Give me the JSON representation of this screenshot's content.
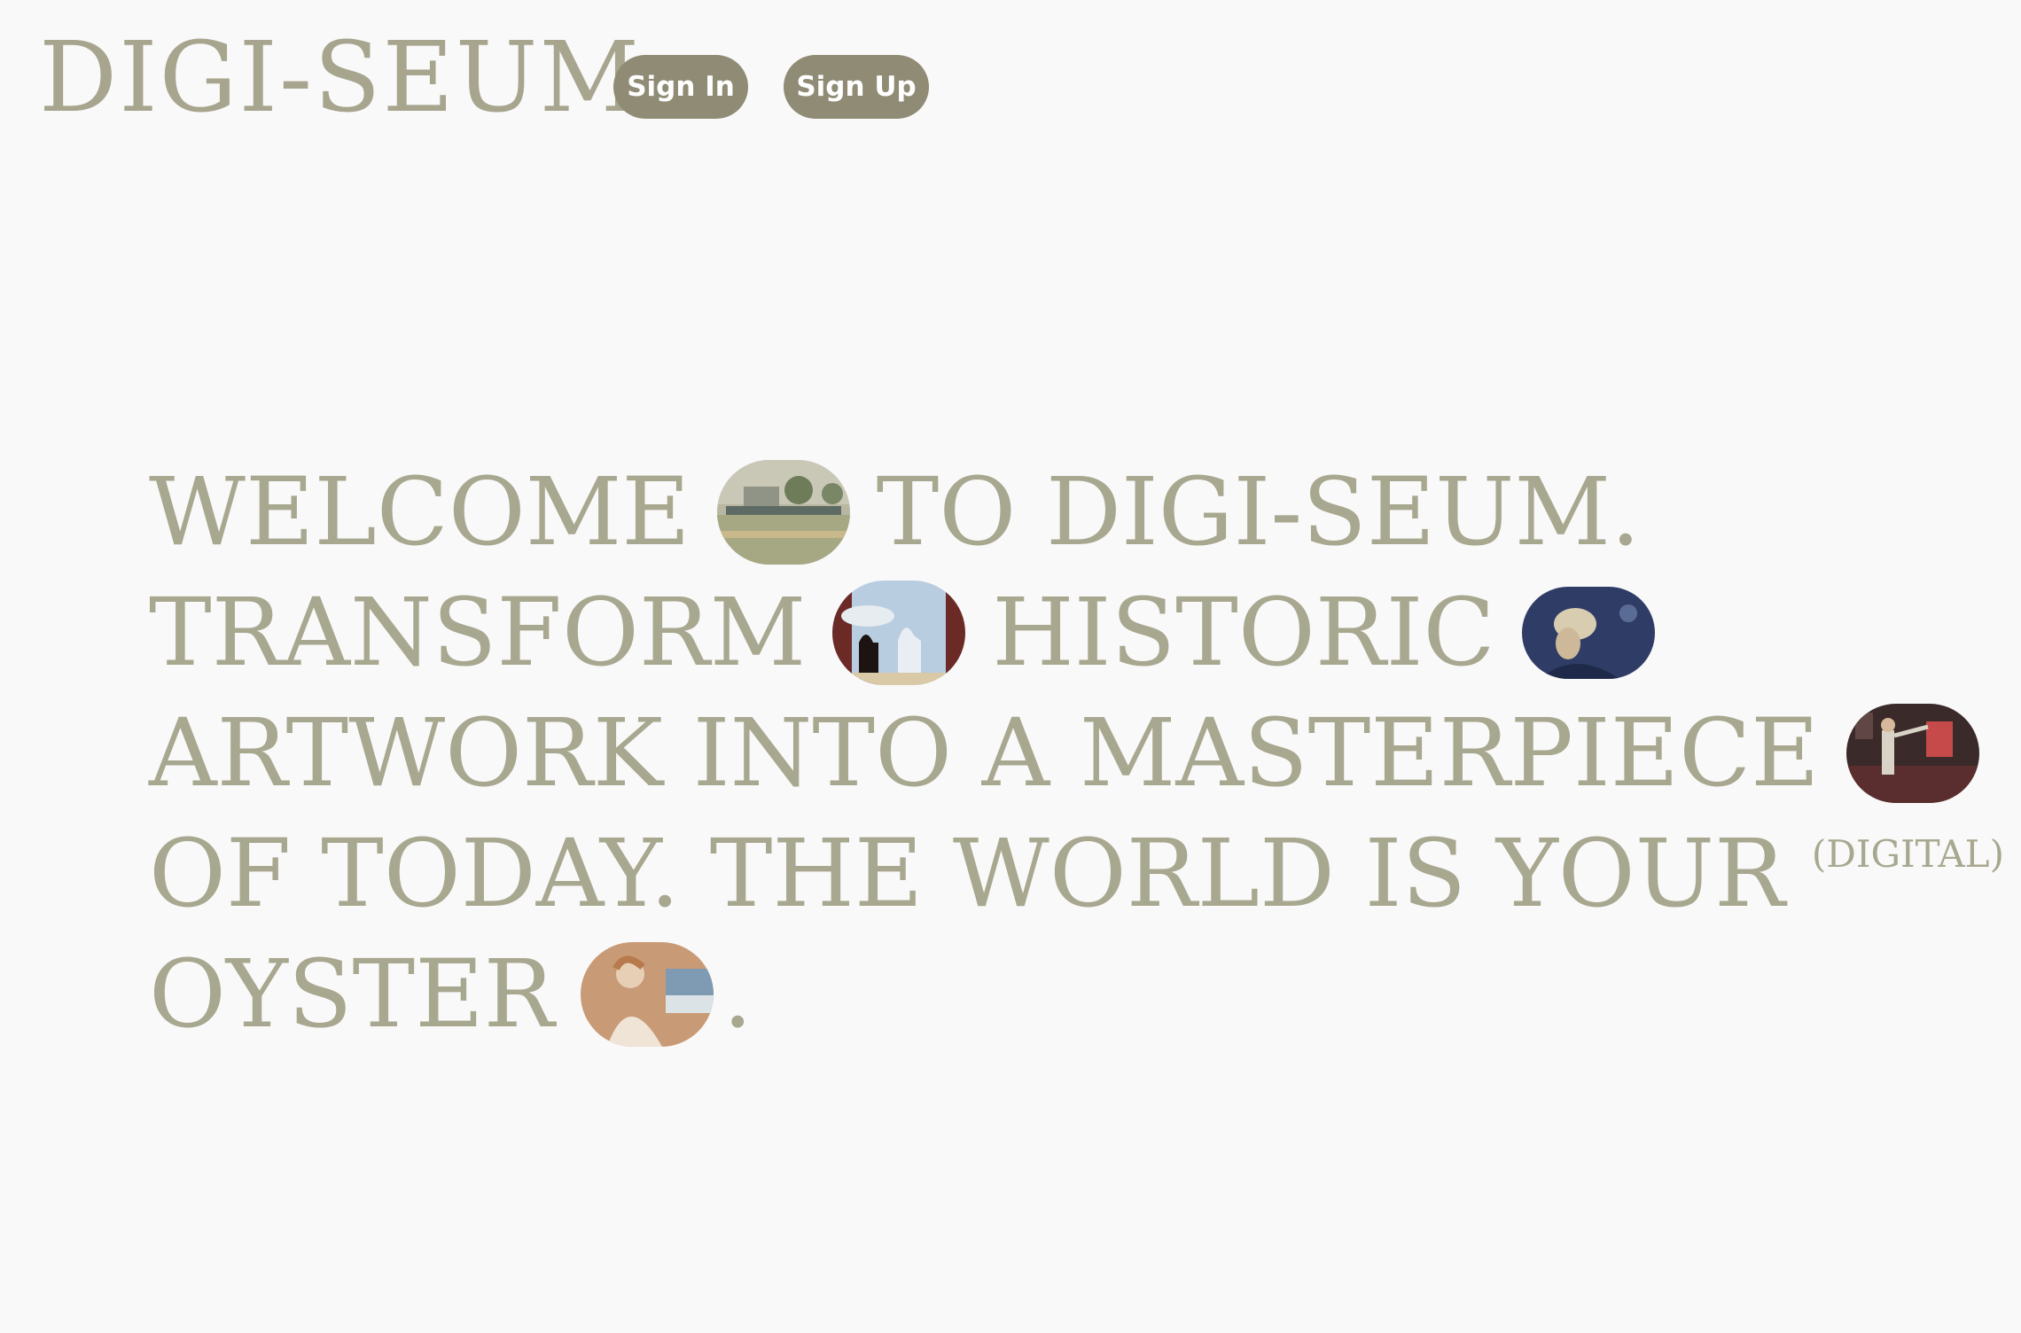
{
  "header": {
    "logo": "DIGI-SEUM",
    "sign_in_label": "Sign In",
    "sign_up_label": "Sign Up"
  },
  "hero": {
    "line1": {
      "a": "WELCOME",
      "b": "TO DIGI-SEUM."
    },
    "line2": {
      "a": "TRANSFORM",
      "b": "HISTORIC"
    },
    "line3": {
      "a": "ARTWORK INTO A MASTERPIECE"
    },
    "line4": {
      "a": "OF TODAY. THE WORLD IS YOUR",
      "small": "(DIGITAL)"
    },
    "line5": {
      "a": "OYSTER",
      "b": "."
    },
    "thumbnails": [
      {
        "name": "landscape-painting-thumbnail"
      },
      {
        "name": "silhouette-painting-thumbnail"
      },
      {
        "name": "portrait-painting-thumbnail"
      },
      {
        "name": "performer-scene-thumbnail"
      },
      {
        "name": "seaside-figure-thumbnail"
      }
    ]
  },
  "colors": {
    "background": "#f9f9f9",
    "text": "#a8a78f",
    "button": "#8f8b74",
    "button_text": "#ffffff"
  }
}
